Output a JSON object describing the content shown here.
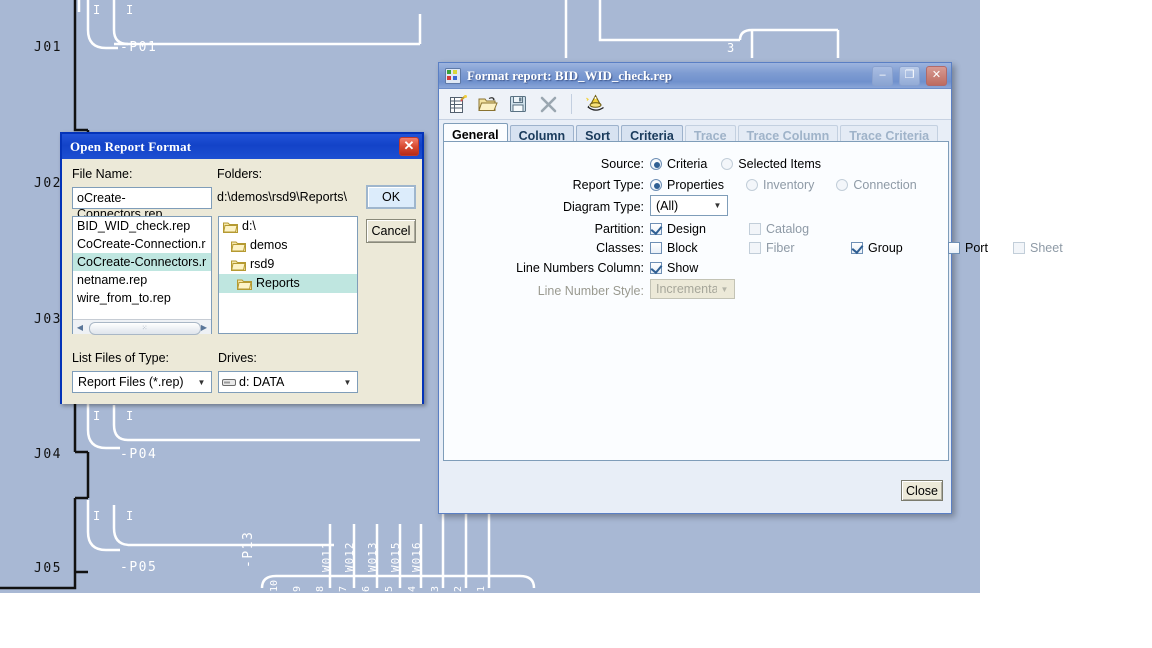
{
  "canvas": {
    "background_color": "#a8b8d4",
    "connector_labels": [
      "J01",
      "J02",
      "J03",
      "J04",
      "J05"
    ],
    "port_labels": [
      "-P01",
      "-P04",
      "-P05",
      "-P13"
    ],
    "wire_labels": [
      "W011",
      "W012",
      "W013",
      "W015",
      "W016"
    ],
    "pin_numbers": [
      "10",
      "9",
      "8",
      "7",
      "6",
      "5",
      "4",
      "3",
      "2",
      "1"
    ],
    "misc_labels": [
      "3"
    ]
  },
  "open_report_dialog": {
    "title": "Open Report Format",
    "close_label": "✕",
    "file_name_label": "File Name:",
    "file_name_value": "oCreate-Connectors.rep",
    "folders_label": "Folders:",
    "folders_path": "d:\\demos\\rsd9\\Reports\\",
    "files": [
      {
        "name": "BID_WID_check.rep",
        "selected": false
      },
      {
        "name": "CoCreate-Connection.r",
        "selected": false
      },
      {
        "name": "CoCreate-Connectors.r",
        "selected": true
      },
      {
        "name": "netname.rep",
        "selected": false
      },
      {
        "name": "wire_from_to.rep",
        "selected": false
      }
    ],
    "folders": [
      {
        "name": "d:\\",
        "selected": false
      },
      {
        "name": "demos",
        "selected": false
      },
      {
        "name": "rsd9",
        "selected": false
      },
      {
        "name": "Reports",
        "selected": true
      }
    ],
    "ok_label": "OK",
    "cancel_label": "Cancel",
    "list_files_label": "List Files of Type:",
    "list_files_value": "Report Files (*.rep)",
    "drives_label": "Drives:",
    "drives_value": "d: DATA",
    "scrollbar_thumb_glyph": "⁙"
  },
  "format_report_window": {
    "title": "Format report: BID_WID_check.rep",
    "app_icon": "report-app-icon",
    "window_buttons": {
      "minimize": "–",
      "maximize": "❐",
      "close": "✕"
    },
    "toolbar": [
      {
        "name": "new-report-icon",
        "label": "New"
      },
      {
        "name": "open-report-icon",
        "label": "Open"
      },
      {
        "name": "save-report-icon",
        "label": "Save"
      },
      {
        "name": "delete-report-icon",
        "label": "Delete"
      },
      {
        "name": "report-wizard-icon",
        "label": "Wizard"
      }
    ],
    "tabs": [
      {
        "label": "General",
        "active": true,
        "disabled": false
      },
      {
        "label": "Column",
        "active": false,
        "disabled": false
      },
      {
        "label": "Sort",
        "active": false,
        "disabled": false
      },
      {
        "label": "Criteria",
        "active": false,
        "disabled": false
      },
      {
        "label": "Trace",
        "active": false,
        "disabled": true
      },
      {
        "label": "Trace Column",
        "active": false,
        "disabled": true
      },
      {
        "label": "Trace Criteria",
        "active": false,
        "disabled": true
      }
    ],
    "general": {
      "source": {
        "label": "Source:",
        "options": [
          {
            "label": "Criteria",
            "checked": true,
            "disabled": false
          },
          {
            "label": "Selected Items",
            "checked": false,
            "disabled": true
          }
        ]
      },
      "report_type": {
        "label": "Report Type:",
        "options": [
          {
            "label": "Properties",
            "checked": true,
            "disabled": false
          },
          {
            "label": "Inventory",
            "checked": false,
            "disabled": true
          },
          {
            "label": "Connection",
            "checked": false,
            "disabled": true
          }
        ]
      },
      "diagram_type": {
        "label": "Diagram Type:",
        "value": "(All)",
        "disabled": false
      },
      "partition": {
        "label": "Partition:",
        "options": [
          {
            "label": "Design",
            "checked": true,
            "disabled": false
          },
          {
            "label": "Catalog",
            "checked": false,
            "disabled": true
          }
        ]
      },
      "classes": {
        "label": "Classes:",
        "options": [
          {
            "label": "Block",
            "checked": false,
            "disabled": false
          },
          {
            "label": "Fiber",
            "checked": false,
            "disabled": true
          },
          {
            "label": "Group",
            "checked": true,
            "disabled": false
          },
          {
            "label": "Port",
            "checked": false,
            "disabled": false
          },
          {
            "label": "Sheet",
            "checked": false,
            "disabled": true
          }
        ]
      },
      "line_numbers_column": {
        "label": "Line Numbers Column:",
        "options": [
          {
            "label": "Show",
            "checked": true,
            "disabled": false
          }
        ]
      },
      "line_number_style": {
        "label": "Line Number Style:",
        "value": "Incremental",
        "disabled": true
      }
    },
    "close_label": "Close"
  },
  "colors": {
    "canvas_bg": "#a8b8d4",
    "open_dialog_border": "#0433b8",
    "open_dialog_titlebar": "#1343c8",
    "format_titlebar": "#7e9cd2",
    "selection_highlight": "#bfe6e0",
    "accent_blue": "#2f5f93"
  }
}
